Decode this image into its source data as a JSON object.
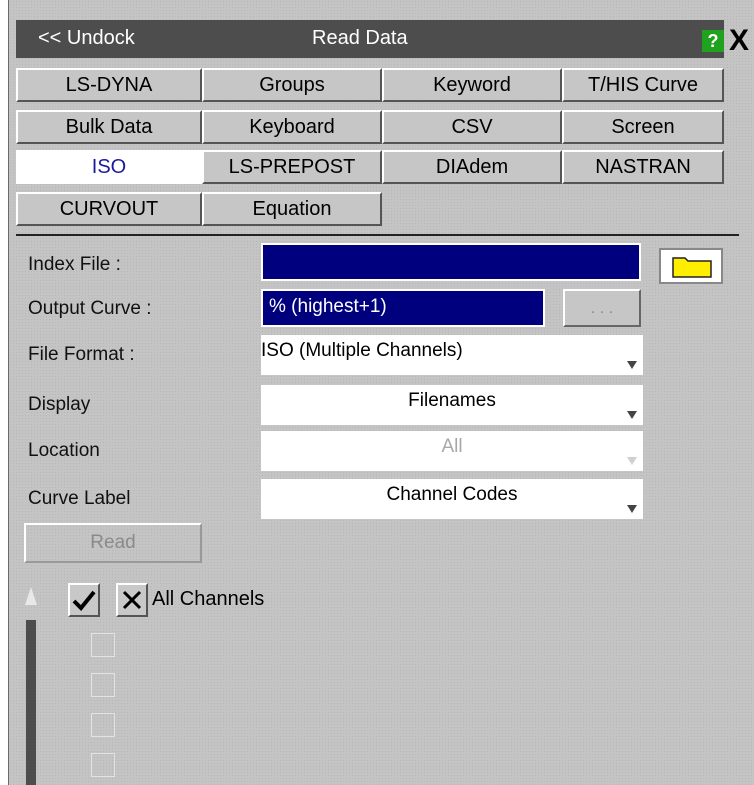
{
  "title_bar": {
    "undock_label": "<< Undock",
    "title": "Read Data",
    "help_label": "?",
    "close_label": "X"
  },
  "tabs": [
    {
      "label": "LS-DYNA"
    },
    {
      "label": "Groups"
    },
    {
      "label": "Keyword"
    },
    {
      "label": "T/HIS Curve"
    },
    {
      "label": "Bulk Data"
    },
    {
      "label": "Keyboard"
    },
    {
      "label": "CSV"
    },
    {
      "label": "Screen"
    },
    {
      "label": "ISO",
      "active": true
    },
    {
      "label": "LS-PREPOST"
    },
    {
      "label": "DIAdem"
    },
    {
      "label": "NASTRAN"
    },
    {
      "label": "CURVOUT"
    },
    {
      "label": "Equation"
    }
  ],
  "form": {
    "index_file": {
      "label": "Index File :",
      "value": ""
    },
    "output_curve": {
      "label": "Output Curve :",
      "value": "% (highest+1)",
      "browse_label": ". . ."
    },
    "file_format": {
      "label": "File Format :",
      "value": "ISO (Multiple Channels)"
    },
    "display": {
      "label": "Display",
      "value": "Filenames"
    },
    "location": {
      "label": "Location",
      "value": "All"
    },
    "curve_label": {
      "label": "Curve Label",
      "value": "Channel Codes"
    }
  },
  "read_button": "Read",
  "channels": {
    "all_label": "All Channels",
    "items": [
      {
        "checked": false
      },
      {
        "checked": false
      },
      {
        "checked": false
      },
      {
        "checked": false
      }
    ]
  },
  "colors": {
    "panel_bg": "#c4c4c4",
    "titlebar_bg": "#4d4d4d",
    "field_blue": "#00007f",
    "help_green": "#1fa31f",
    "active_tab_text": "#1a1a9c",
    "folder_yellow": "#ffee00"
  },
  "icons": {
    "folder": "folder-icon",
    "select_all": "checkmark-icon",
    "deselect_all": "cross-icon",
    "scroll_up": "scroll-up-arrow-icon"
  }
}
